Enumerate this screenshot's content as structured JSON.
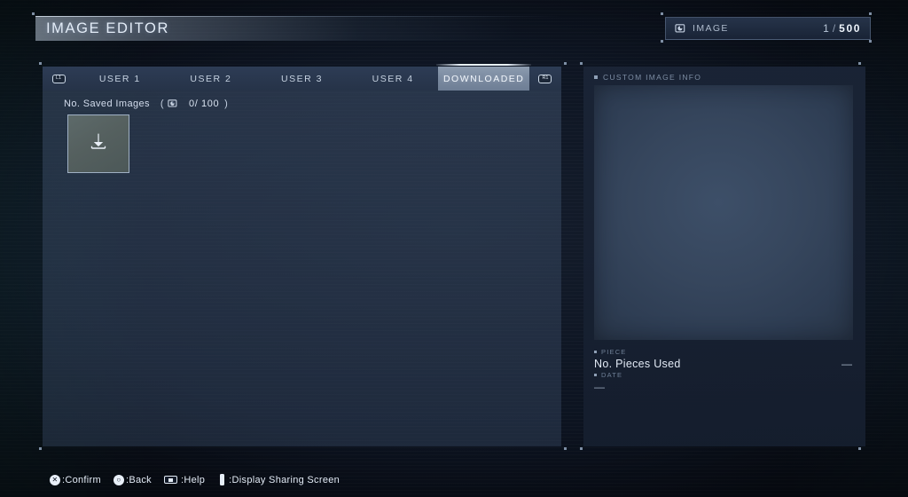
{
  "header": {
    "title": "IMAGE EDITOR"
  },
  "image_counter": {
    "icon": "image-icon",
    "label": "IMAGE",
    "current": "1",
    "separator": "/",
    "max": "500"
  },
  "tabs": {
    "left_shoulder": "L1",
    "right_shoulder": "R1",
    "items": [
      {
        "label": "USER 1",
        "selected": false
      },
      {
        "label": "USER 2",
        "selected": false
      },
      {
        "label": "USER 3",
        "selected": false
      },
      {
        "label": "USER 4",
        "selected": false
      },
      {
        "label": "DOWNLOADED",
        "selected": true
      }
    ]
  },
  "saved_images": {
    "label": "No. Saved Images",
    "open_paren": "(",
    "icon": "image-icon",
    "count": "0/ 100",
    "close_paren": ")"
  },
  "slot": {
    "icon": "download-icon",
    "name": "download-slot"
  },
  "info_panel": {
    "header": "CUSTOM IMAGE INFO",
    "preview": {
      "name": "image-preview",
      "empty": true
    },
    "piece": {
      "tag": "PIECE",
      "label": "No. Pieces Used",
      "value": "—"
    },
    "date": {
      "tag": "DATE",
      "value": "—"
    }
  },
  "footer": {
    "actions": [
      {
        "glyph": "cross-button-icon",
        "symbol": "✕",
        "text": ":Confirm"
      },
      {
        "glyph": "circle-button-icon",
        "symbol": "○",
        "text": ":Back"
      },
      {
        "glyph": "touchpad-button-icon",
        "symbol": "",
        "text": ":Help"
      },
      {
        "glyph": "options-button-icon",
        "symbol": "",
        "text": ":Display Sharing Screen"
      }
    ]
  },
  "colors": {
    "background": "#0d1420",
    "panel": "#3a4c66",
    "panel_dark": "#1a2436",
    "accent_text": "#e3ecf7",
    "tab_selected": "#7b8ba1",
    "muted_text": "#7d8da3"
  }
}
